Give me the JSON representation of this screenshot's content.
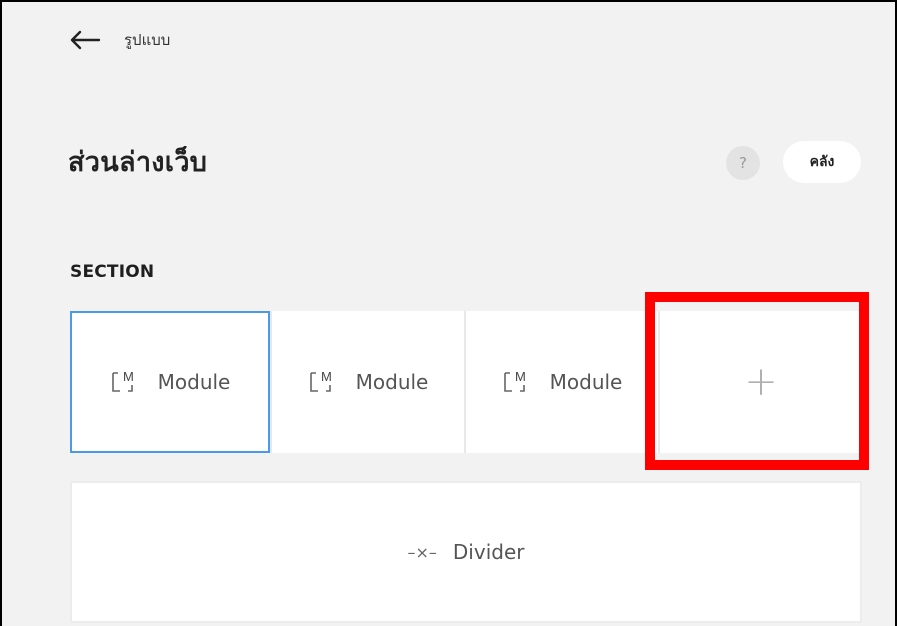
{
  "header": {
    "back_icon": "arrow-left-icon",
    "breadcrumb": "รูปแบบ"
  },
  "title": "ส่วนล่างเว็บ",
  "help": {
    "label": "?"
  },
  "library_button": {
    "label": "คลัง"
  },
  "section": {
    "label": "SECTION",
    "modules": [
      {
        "label": "Module",
        "icon": "module-icon",
        "selected": true
      },
      {
        "label": "Module",
        "icon": "module-icon",
        "selected": false
      },
      {
        "label": "Module",
        "icon": "module-icon",
        "selected": false
      }
    ],
    "add_label": "+"
  },
  "divider": {
    "icon_text": "–×–",
    "label": "Divider"
  },
  "colors": {
    "selected_border": "#4a9ae8",
    "highlight": "#ff0000"
  }
}
